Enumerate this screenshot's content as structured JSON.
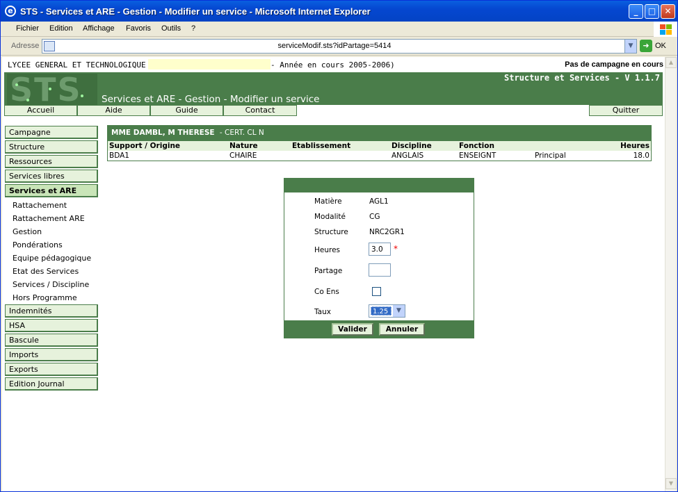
{
  "window": {
    "title": "STS - Services et ARE - Gestion - Modifier un service - Microsoft Internet Explorer",
    "menu": [
      "Fichier",
      "Edition",
      "Affichage",
      "Favoris",
      "Outils",
      "?"
    ],
    "address_label": "Adresse",
    "url": "serviceModif.sts?idPartage=5414",
    "go_label": "OK"
  },
  "header": {
    "school": "LYCEE GENERAL ET TECHNOLOGIQUE",
    "year": "- Année en cours 2005-2006)",
    "campaign": "Pas de campagne en cours",
    "version": "Structure et Services - V 1.1.7",
    "logo": "STS",
    "page_title": "Services et ARE - Gestion - Modifier un service"
  },
  "topnav": [
    "Accueil",
    "Aide",
    "Guide",
    "Contact",
    "Quitter"
  ],
  "sidebar": {
    "items_top": [
      "Campagne",
      "Structure",
      "Ressources",
      "Services libres",
      "Services et ARE"
    ],
    "subitems": [
      "Rattachement",
      "Rattachement ARE",
      "Gestion",
      "Pondérations",
      "Equipe pédagogique",
      "Etat des Services",
      "Services / Discipline",
      "Hors Programme"
    ],
    "items_bottom": [
      "Indemnités",
      "HSA",
      "Bascule",
      "Imports",
      "Exports",
      "Edition Journal"
    ]
  },
  "teacher": {
    "name": "MME DAMBL, M THERESE",
    "grade": "- CERT. CL N",
    "columns": [
      "Support / Origine",
      "Nature",
      "Etablissement",
      "Discipline",
      "Fonction",
      "Heures"
    ],
    "row": {
      "support": "BDA1",
      "nature": "CHAIRE",
      "etablissement": "",
      "discipline": "ANGLAIS",
      "fonction": "ENSEIGNT",
      "type": "Principal",
      "heures": "18.0"
    }
  },
  "form": {
    "matiere_label": "Matière",
    "matiere": "AGL1",
    "modalite_label": "Modalité",
    "modalite": "CG",
    "structure_label": "Structure",
    "structure": "NRC2GR1",
    "heures_label": "Heures",
    "heures": "3.0",
    "partage_label": "Partage",
    "partage": "",
    "coens_label": "Co Ens",
    "taux_label": "Taux",
    "taux": "1.25",
    "valider": "Valider",
    "annuler": "Annuler",
    "required_mark": "*"
  }
}
